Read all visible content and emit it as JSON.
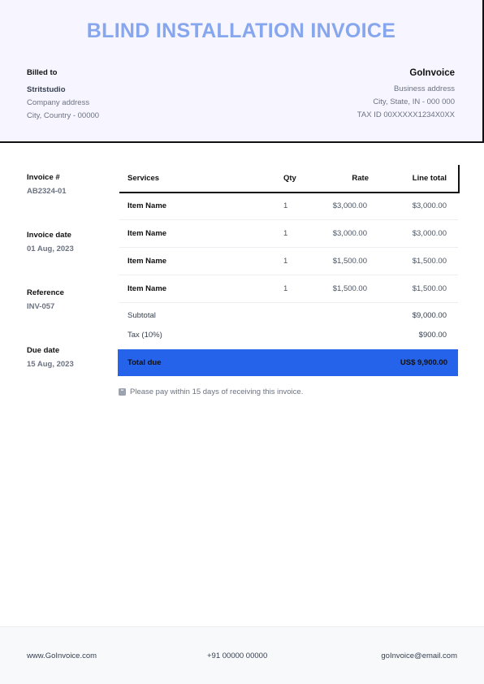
{
  "title": "BLIND INSTALLATION INVOICE",
  "billed_to": {
    "label": "Billed to",
    "name": "Stritstudio",
    "address": "Company address",
    "city": "City, Country - 00000"
  },
  "company": {
    "name": "GoInvoice",
    "address": "Business address",
    "city": "City, State, IN - 000 000",
    "tax": "TAX ID 00XXXXX1234X0XX"
  },
  "meta": [
    {
      "label": "Invoice #",
      "value": "AB2324-01"
    },
    {
      "label": "Invoice date",
      "value": "01 Aug, 2023"
    },
    {
      "label": "Reference",
      "value": "INV-057"
    },
    {
      "label": "Due date",
      "value": "15 Aug, 2023"
    }
  ],
  "table": {
    "headers": {
      "services": "Services",
      "qty": "Qty",
      "rate": "Rate",
      "line_total": "Line total"
    },
    "rows": [
      {
        "item": "Item Name",
        "qty": "1",
        "rate": "$3,000.00",
        "total": "$3,000.00"
      },
      {
        "item": "Item Name",
        "qty": "1",
        "rate": "$3,000.00",
        "total": "$3,000.00"
      },
      {
        "item": "Item Name",
        "qty": "1",
        "rate": "$1,500.00",
        "total": "$1,500.00"
      },
      {
        "item": "Item Name",
        "qty": "1",
        "rate": "$1,500.00",
        "total": "$1,500.00"
      }
    ]
  },
  "summary": {
    "subtotal_label": "Subtotal",
    "subtotal_value": "$9,000.00",
    "tax_label": "Tax (10%)",
    "tax_value": "$900.00",
    "total_label": "Total due",
    "total_value": "US$ 9,900.00"
  },
  "note": "Please pay within 15 days of receiving this invoice.",
  "note_icon": "quote-icon",
  "footer": {
    "website": "www.GoInvoice.com",
    "phone": "+91 00000 00000",
    "email": "goInvoice@email.com"
  },
  "colors": {
    "title": "#86a6ee",
    "header_bg": "#f7f5ff",
    "total_bg": "#2563eb",
    "footer_bg": "#f8f9fb"
  }
}
